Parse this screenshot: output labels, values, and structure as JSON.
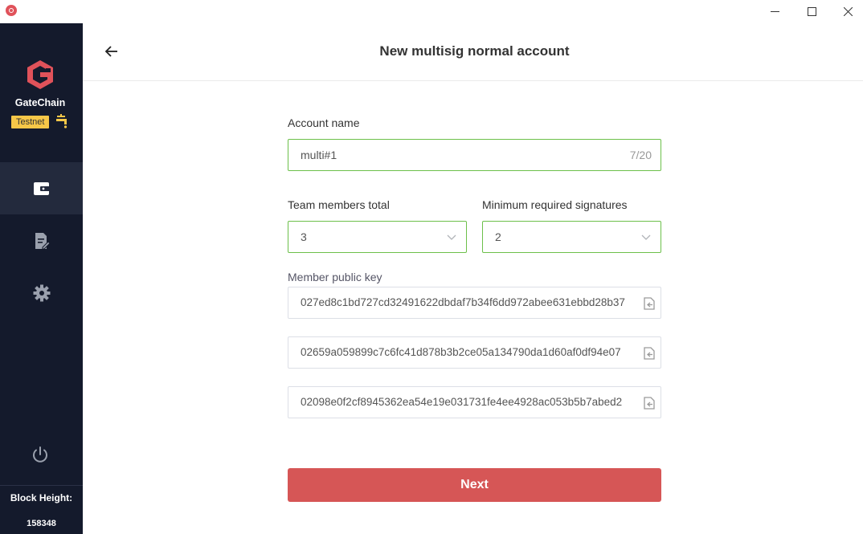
{
  "sidebar": {
    "brand_name": "GateChain",
    "network_badge": "Testnet",
    "block_height_label": "Block Height:",
    "block_height_value": "158348",
    "nav": [
      {
        "name": "wallet",
        "active": true
      },
      {
        "name": "records",
        "active": false
      },
      {
        "name": "settings",
        "active": false
      }
    ]
  },
  "header": {
    "title": "New multisig normal account"
  },
  "form": {
    "account_name_label": "Account name",
    "account_name_value": "multi#1",
    "account_name_counter": "7/20",
    "team_members_label": "Team members total",
    "team_members_value": "3",
    "min_signatures_label": "Minimum required signatures",
    "min_signatures_value": "2",
    "public_key_label": "Member public key",
    "public_keys": [
      "027ed8c1bd727cd32491622dbdaf7b34f6dd972abee631ebbd28b37",
      "02659a059899c7c6fc41d878b3b2ce05a134790da1d60af0df94e07",
      "02098e0f2cf8945362ea54e19e031731fe4ee4928ac053b5b7abed2"
    ],
    "next_label": "Next"
  },
  "colors": {
    "sidebar_bg": "#141a2c",
    "accent_green": "#6cc04a",
    "primary_red": "#d65656",
    "badge_yellow": "#f6c748"
  }
}
